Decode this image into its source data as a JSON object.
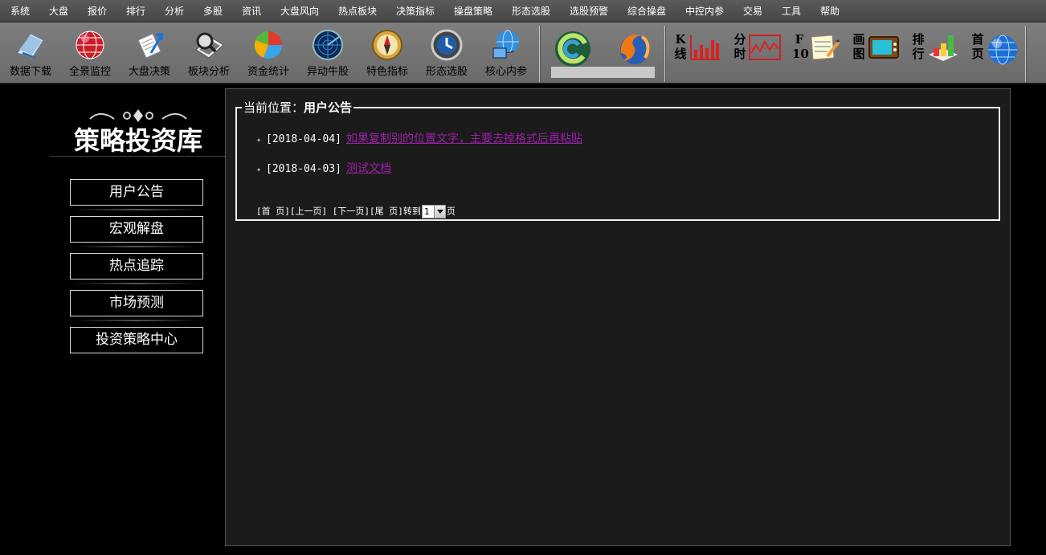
{
  "menu": [
    "系统",
    "大盘",
    "报价",
    "排行",
    "分析",
    "多股",
    "资讯",
    "大盘风向",
    "热点板块",
    "决策指标",
    "操盘策略",
    "形态选股",
    "选股预警",
    "综合操盘",
    "中控内参",
    "交易",
    "工具",
    "帮助"
  ],
  "toolbar": {
    "buttons": [
      {
        "label": "数据下载",
        "icon": "download-doc-icon"
      },
      {
        "label": "全景监控",
        "icon": "globe-monitor-icon"
      },
      {
        "label": "大盘决策",
        "icon": "document-arrow-icon"
      },
      {
        "label": "板块分析",
        "icon": "magnifier-book-icon"
      },
      {
        "label": "资金统计",
        "icon": "pie-chart-icon"
      },
      {
        "label": "异动牛股",
        "icon": "radar-icon"
      },
      {
        "label": "特色指标",
        "icon": "compass-icon"
      },
      {
        "label": "形态选股",
        "icon": "clock-icon"
      },
      {
        "label": "核心内参",
        "icon": "network-globe-icon"
      }
    ],
    "quick": [
      {
        "text": "K\n线",
        "icon": "kline-chart-icon"
      },
      {
        "text": "分\n时",
        "icon": "intraday-chart-icon"
      },
      {
        "text": "F\n10",
        "icon": "notepad-icon"
      },
      {
        "text": "画\n图",
        "icon": "tv-screen-icon"
      },
      {
        "text": "排\n行",
        "icon": "bar-rank-icon"
      },
      {
        "text": "首\n页",
        "icon": "home-globe-icon"
      }
    ]
  },
  "sidebar": {
    "logo_text": "策略投资库",
    "items": [
      "用户公告",
      "宏观解盘",
      "热点追踪",
      "市场预测",
      "投资策略中心"
    ]
  },
  "content": {
    "location_label": "当前位置：",
    "location_value": "用户公告",
    "notices": [
      {
        "date": "[2018-04-04]",
        "title": "如果复制别的位置文字，主要去掉格式后再粘贴"
      },
      {
        "date": "[2018-04-03]",
        "title": "测试文档"
      }
    ],
    "pager": {
      "first": "[首 页]",
      "prev": "[上一页]",
      "next": "[下一页]",
      "last": "[尾 页]",
      "goto": "转到",
      "page_value": "1",
      "page_suffix": "页"
    }
  },
  "colors": {
    "link": "#9b1fa8",
    "menu_bg": "#4f4f4f",
    "toolbar_bg": "#747474",
    "panel_bg": "#1b1b1b"
  }
}
